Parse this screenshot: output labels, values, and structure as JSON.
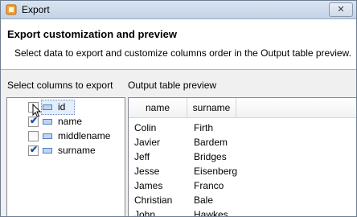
{
  "window": {
    "title": "Export",
    "close_glyph": "✕"
  },
  "header": {
    "title": "Export customization and preview",
    "description": "Select data to export and customize columns order in the Output table preview."
  },
  "columns_panel": {
    "label": "Select columns to export",
    "items": [
      {
        "label": "id",
        "checked": false,
        "selected": true
      },
      {
        "label": "name",
        "checked": true,
        "selected": false
      },
      {
        "label": "middlename",
        "checked": false,
        "selected": false
      },
      {
        "label": "surname",
        "checked": true,
        "selected": false
      }
    ]
  },
  "preview_panel": {
    "label": "Output table preview",
    "headers": [
      "name",
      "surname"
    ],
    "rows": [
      {
        "name": "Colin",
        "surname": "Firth"
      },
      {
        "name": "Javier",
        "surname": "Bardem"
      },
      {
        "name": "Jeff",
        "surname": "Bridges"
      },
      {
        "name": "Jesse",
        "surname": "Eisenberg"
      },
      {
        "name": "James",
        "surname": "Franco"
      },
      {
        "name": "Christian",
        "surname": "Bale"
      },
      {
        "name": "John",
        "surname": "Hawkes"
      }
    ]
  },
  "icons": {
    "app": "export-app-icon",
    "field": "field-icon",
    "check": "✔"
  }
}
